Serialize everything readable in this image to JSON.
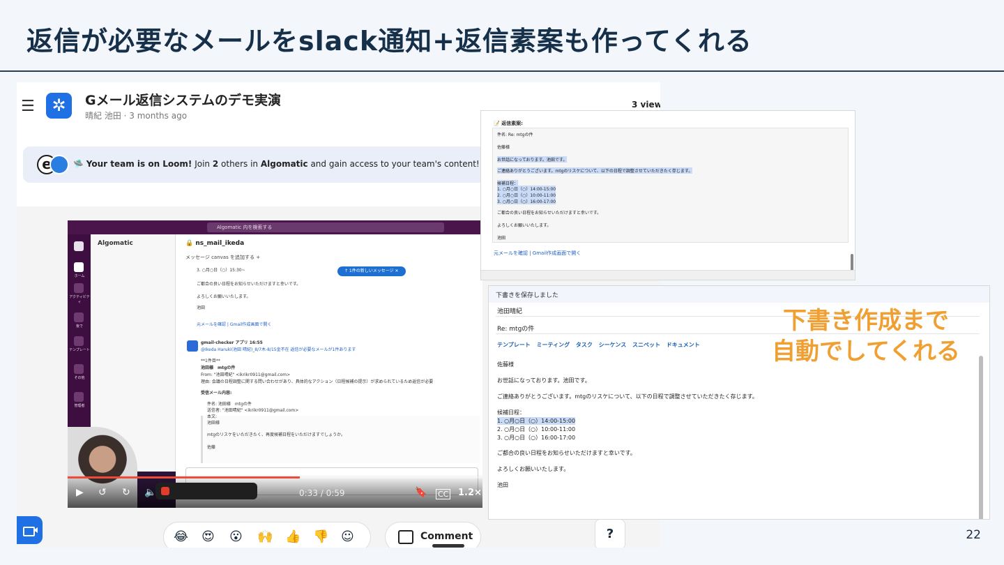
{
  "slide": {
    "title": "返信が必要なメールをslack通知+返信素案も作ってくれる",
    "page_number": "22",
    "callout_line1": "下書き作成まで",
    "callout_line2": "自動でしてくれる"
  },
  "loom": {
    "video_title": "Gメール返信システムのデモ実演",
    "author_meta": "晴紀 池田 · 3 months ago",
    "views": "3 views",
    "banner_lead": "Your team is on Loom!",
    "banner_middle": " Join ",
    "banner_count": "2",
    "banner_middle2": " others in ",
    "banner_org": "Algomatic",
    "banner_tail": " and gain access to your team's content!",
    "comment_label": "Comment",
    "help_label": "?",
    "reactions": [
      "😂",
      "😍",
      "😮",
      "🙌",
      "👍",
      "👎",
      "☺"
    ],
    "player": {
      "time": "0:33 / 0:59",
      "speed": "1.2×",
      "progress": 0.56
    }
  },
  "slack": {
    "search_placeholder": "Algomatic 内を検索する",
    "workspace": "Algomatic",
    "channel": "ns_mail_ikeda",
    "tabs": "メッセージ   canvas を追加する   +",
    "new_message_pill": "↑ 1件の新しいメッセージ  ✕",
    "rail_labels": [
      "ホーム",
      "アクティビティ",
      "後で",
      "テンプレート",
      "その他",
      "管理者"
    ],
    "lines": [
      "3. ○月○日（○）15:30~",
      "ご都合の良い日程をお知らせいただけますと幸いです。",
      "よろしくお願いいたします。",
      "池田",
      "元メールを確認 | Gmail作成画面で開く",
      "gmail-checker アプリ 16:55",
      "@Ikeda Haruki(池田 晴紀)_8/7木-8/15金不在 返信が必要なメールが1件あります",
      "**1件目**",
      "池田様　mtgの件",
      "From: \"池田晴紀\" <ikrikr0911@gmail.com>",
      "理由: 会議の日程調整に関する問い合わせがあり、具体的なアクション（日程候補の提示）が求められているため返信が必要",
      "受信メール内容:"
    ],
    "quote_lines": [
      "件名: 池田様　mtgの件",
      "送信者: \"池田晴紀\" <ikrikr0911@gmail.com>",
      "本文:",
      "池田様",
      "mtgのリスケをいただきたく、再度候補日程をいただけますでしょうか。",
      "佐藤"
    ]
  },
  "reply_draft": {
    "heading": "返信素案:",
    "lines": [
      "件名: Re: mtgの件",
      "佐藤様",
      "お世話になっております。池田です。",
      "ご連絡ありがとうございます。mtgのリスケについて、以下の日程で調整させていただきたく存じます。",
      "候補日程：",
      "1. ○月○日（○）14:00-15:00",
      "2. ○月○日（○）10:00-11:00",
      "3. ○月○日（○）16:00-17:00",
      "ご都合の良い日程をお知らせいただけますと幸いです。",
      "よろしくお願いいたします。",
      "池田"
    ],
    "link": "元メールを確認 | Gmail作成画面で開く"
  },
  "gmail_draft": {
    "status": "下書きを保存しました",
    "to": "池田晴紀",
    "subject": "Re: mtgの件",
    "toolbar": "テンプレート  ミーティング  タスク  シーケンス  スニペット  ドキュメント",
    "body": [
      "佐藤様",
      "お世話になっております。池田です。",
      "ご連絡ありがとうございます。mtgのリスケについて、以下の日程で調整させていただきたく存じます。",
      "候補日程：",
      "1. ○月○日（○）14:00-15:00",
      "2. ○月○日（○）10:00-11:00",
      "3. ○月○日（○）16:00-17:00",
      "ご都合の良い日程をお知らせいただけますと幸いです。",
      "よろしくお願いいたします。",
      "池田"
    ]
  }
}
